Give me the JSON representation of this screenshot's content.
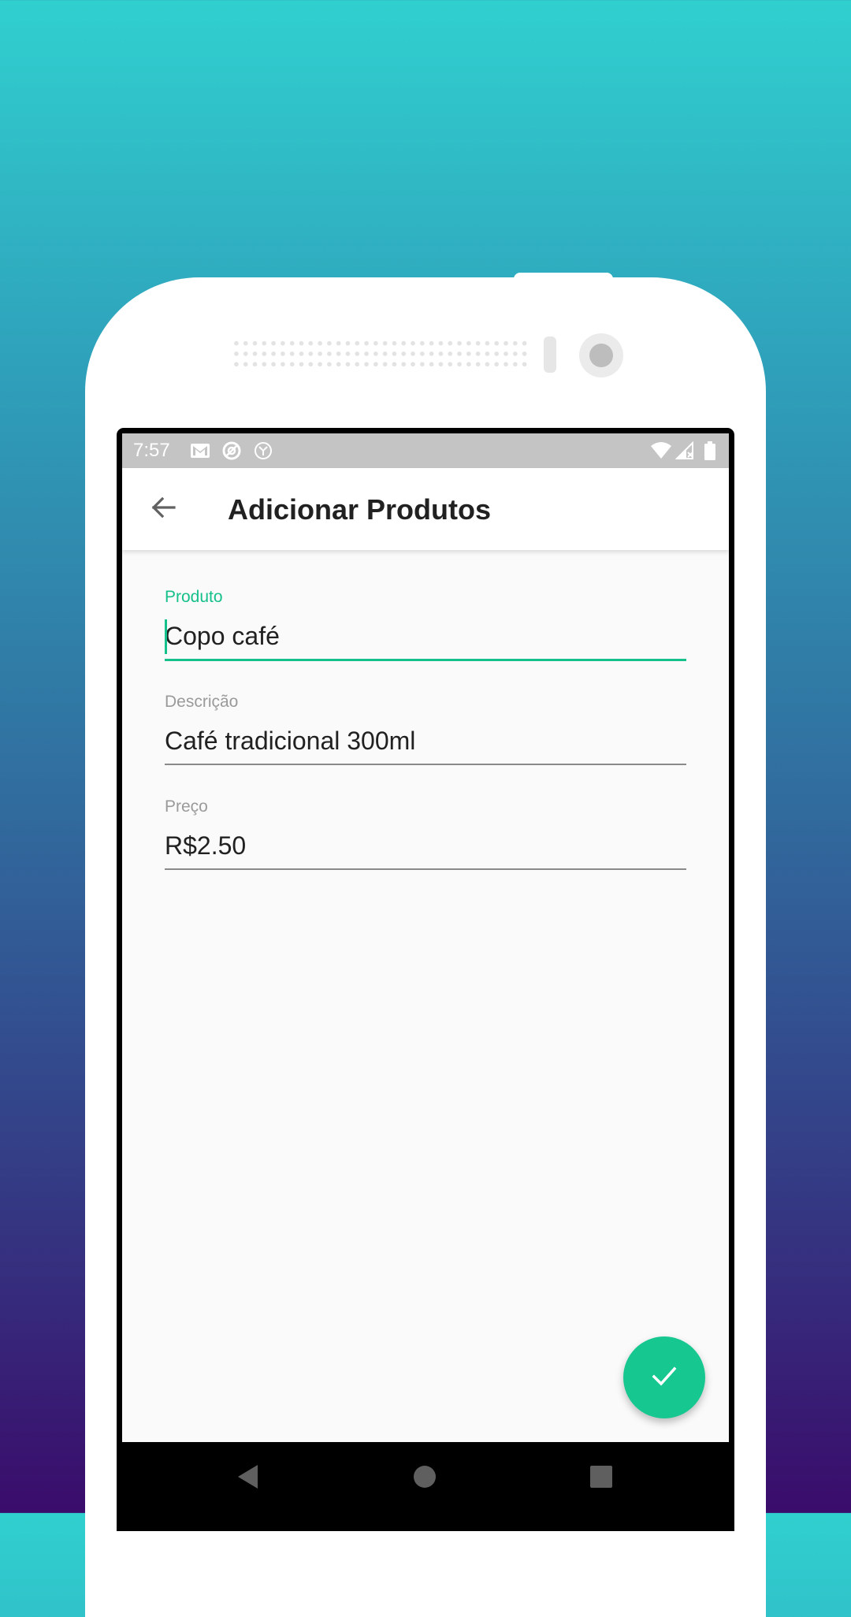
{
  "status_bar": {
    "time": "7:57",
    "left_icons": [
      "gmail-icon",
      "sync-icon",
      "app-notification-icon"
    ],
    "right_icons": [
      "wifi-icon",
      "signal-icon",
      "battery-icon"
    ]
  },
  "app_bar": {
    "back_icon": "arrow-back-icon",
    "title": "Adicionar Produtos"
  },
  "form": {
    "fields": [
      {
        "label": "Produto",
        "value": "Copo café",
        "focused": true
      },
      {
        "label": "Descrição",
        "value": "Café tradicional 300ml",
        "focused": false
      },
      {
        "label": "Preço",
        "value": "R$2.50",
        "focused": false
      }
    ]
  },
  "fab": {
    "icon": "check-icon"
  },
  "nav_bar": {
    "icons": [
      "nav-back-icon",
      "nav-home-icon",
      "nav-recents-icon"
    ]
  },
  "colors": {
    "accent": "#16c08a",
    "fab": "#16c890",
    "status_bar": "#c4c4c4",
    "background_top": "#30d0cf",
    "background_bottom": "#3a0c6b"
  }
}
